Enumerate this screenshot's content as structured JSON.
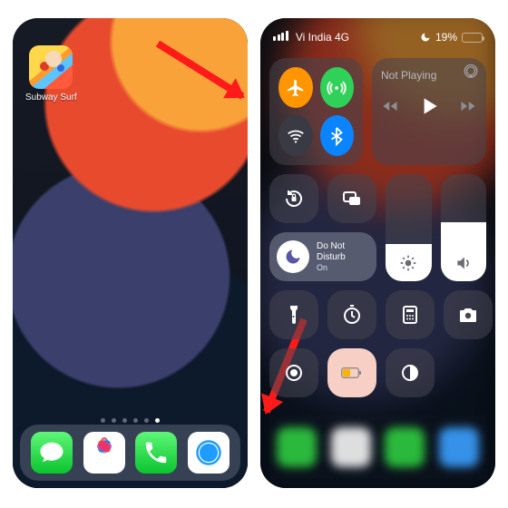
{
  "home": {
    "app": {
      "name": "subway-surfers",
      "label": "Subway Surf"
    },
    "page_dots": {
      "count": 6,
      "active_index": 5
    },
    "dock": [
      {
        "name": "messages",
        "color_top": "#5ef777",
        "color_bottom": "#0bc42f"
      },
      {
        "name": "photos"
      },
      {
        "name": "phone",
        "color_top": "#5ef777",
        "color_bottom": "#0bc42f"
      },
      {
        "name": "safari"
      }
    ]
  },
  "annotations": {
    "arrow1_target": "control-center-swipe",
    "arrow2_target": "do-not-disturb-tile"
  },
  "control_center": {
    "status": {
      "carrier": "Vi India 4G",
      "dnd_active": true,
      "battery_pct": "19%",
      "battery_fill_pct": 19,
      "battery_low_color": "#ffd60a"
    },
    "connectivity": {
      "airplane": {
        "on": true,
        "bg": "#ff9500"
      },
      "cellular": {
        "on": true,
        "bg": "#30d158"
      },
      "wifi": {
        "on": false,
        "bg": "#3a3a44"
      },
      "bluetooth": {
        "on": true,
        "bg": "#0a84ff"
      }
    },
    "media": {
      "title": "Not Playing"
    },
    "focus": {
      "title": "Do Not",
      "title2": "Disturb",
      "subtitle": "On",
      "moon_color": "#5856a6"
    },
    "brightness_pct": 35,
    "volume_pct": 55,
    "grid_row1": [
      {
        "name": "flashlight"
      },
      {
        "name": "timer"
      },
      {
        "name": "calculator"
      },
      {
        "name": "camera"
      }
    ],
    "grid_row2": [
      {
        "name": "screen-record"
      },
      {
        "name": "low-power-mode",
        "tile_bg": "#f7cfc5",
        "icon_color": "#ffb300"
      },
      {
        "name": "dark-mode"
      }
    ]
  }
}
